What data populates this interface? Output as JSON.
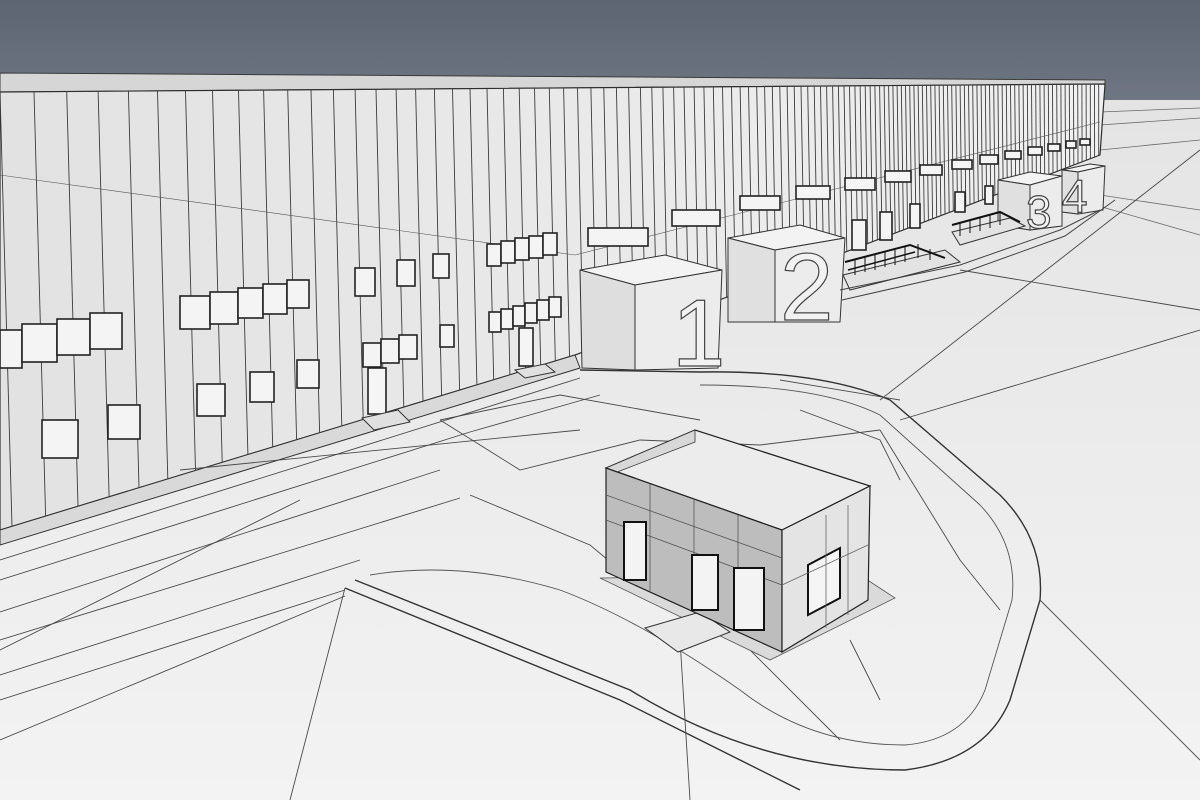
{
  "scene": {
    "sky_color": "#626977",
    "ground_color": "#ebebeb",
    "facade_color": "#e9e9e9",
    "line_color": "#3a3a3a"
  },
  "loading_bays": [
    {
      "number": "1"
    },
    {
      "number": "2"
    },
    {
      "number": "3"
    },
    {
      "number": "4"
    }
  ]
}
